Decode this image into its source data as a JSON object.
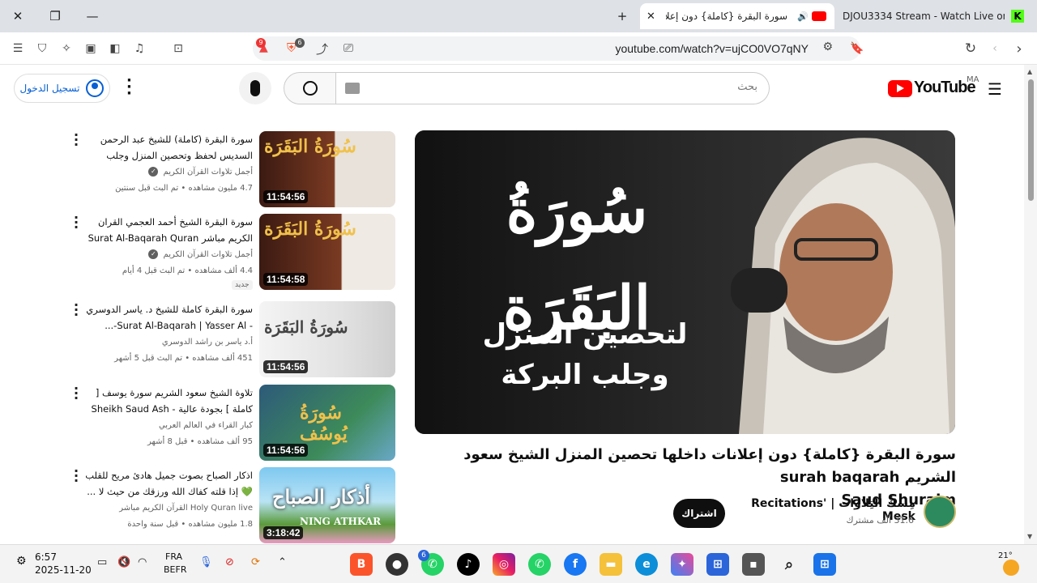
{
  "browser": {
    "tabs": [
      {
        "title": "سورة البقرة {كاملة} دون إعلانات",
        "active": true
      },
      {
        "title": "DJOU3334 Stream - Watch Live on K",
        "active": false
      }
    ],
    "new_tab_label": "+",
    "url": "youtube.com/watch?v=ujCO0VO7qNY",
    "badges": {
      "alerts": "9",
      "brave": "6"
    }
  },
  "youtube": {
    "logo_text": "YouTube",
    "region": "MA",
    "search_placeholder": "بحث",
    "signin_label": "تسجيل الدخول"
  },
  "video": {
    "thumb_title_big": "سُورَةُ البَقَرَة",
    "thumb_sub1": "لتحصين المنزل",
    "thumb_sub2": "وجلب البركة",
    "title_line1": "سورة البقرة {كاملة} دون إعلانات داخلها تحصين المنزل الشيخ سعود الشريم surah baqarah",
    "title_line2": "Saud Shuraim",
    "channel_name": "مِسكُ التِلاوات | Recitations' Mesk",
    "subscribers": "31.6 ألف مشترك",
    "subscribe_label": "اشتراك"
  },
  "related": [
    {
      "title": "سورة البقرة (كاملة) للشيخ عبد الرحمن السديس لحفظ وتحصين المنزل وجلب البرك...",
      "channel": "أجمل تلاوات القرآن الكريم",
      "verified": true,
      "meta": "4.7 مليون مشاهده • تم البث قبل سنتين",
      "duration": "11:54:56",
      "thumb_text": "سُورَةُ البَقَرَة"
    },
    {
      "title": "سورة البقرة الشيخ أحمد العجمي القران الكريم مباشر Surat Al-Baqarah Quran ...",
      "channel": "أجمل تلاوات القرآن الكريم",
      "verified": true,
      "meta": "4.4 ألف مشاهده • تم البث قبل 4 أيام",
      "badge": "جديد",
      "duration": "11:54:58",
      "thumb_text": "سُورَةُ البَقَرَة"
    },
    {
      "title": "سورة البقرة كاملة للشيخ د. ياسر الدوسري - Surat Al-Baqarah | Yasser Al-...",
      "channel": "أ.د ياسر بن راشد الدوسري",
      "verified": false,
      "meta": "451 ألف مشاهده • تم البث قبل 5 أشهر",
      "duration": "11:54:56",
      "thumb_text": "سُورَةُ البَقَرَة"
    },
    {
      "title": "تلاوة الشيخ سعود الشريم سورة يوسف [ كاملة ] بجودة عالية - Sheikh Saud Ash ...",
      "channel": "كبار القراء في العالم العربي",
      "verified": false,
      "meta": "95 ألف مشاهده • قبل 8 أشهر",
      "duration": "11:54:56",
      "thumb_text": "سُورَةُ يُوسُف"
    },
    {
      "title": "اذكار الصباح بصوت جميل هادئ مريح للقلب 💚 إذا قلته كفاك الله ورزقك من حيث لا ...",
      "channel": "Holy Quran live القرآن الكريم مباشر",
      "verified": false,
      "meta": "1.8 مليون مشاهده • قبل سنة واحدة",
      "duration": "3:18:42",
      "thumb_text": "أذكار الصباح",
      "thumb_caption": "NING ATHKAR"
    }
  ],
  "taskbar": {
    "time": "6:57",
    "date": "2025-11-20",
    "lang_top": "FRA",
    "lang_bottom": "BEFR",
    "whatsapp_badge": "6",
    "weather": "21°"
  },
  "colors": {
    "yt_red": "#ff0000",
    "brave_orange": "#fb542b",
    "link_blue": "#065fd4"
  }
}
